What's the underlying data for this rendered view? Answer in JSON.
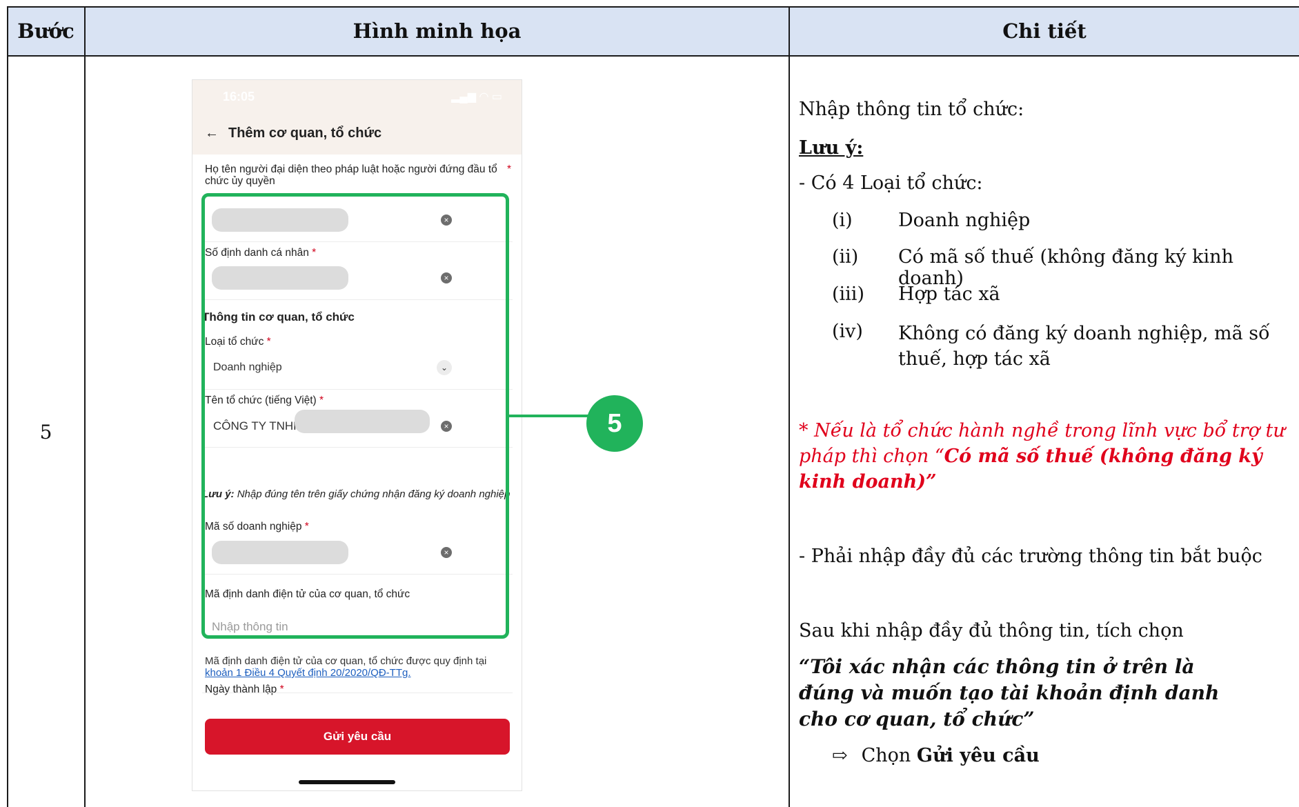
{
  "header": {
    "col_step": "Bước",
    "col_illustration": "Hình minh họa",
    "col_detail": "Chi tiết"
  },
  "step_number": "5",
  "phone": {
    "status_time": "16:05",
    "title": "Thêm cơ quan, tổ chức",
    "rep_label": "Họ tên người đại diện theo pháp luật hoặc người đứng đầu tổ chức ủy quyền",
    "id_label": "Số định danh cá nhân",
    "section_title": "Thông tin cơ quan, tổ chức",
    "org_type_label": "Loại tổ chức",
    "org_type_value": "Doanh nghiệp",
    "org_name_label": "Tên tổ chức (tiếng Việt)",
    "org_name_value": "CÔNG TY TNHH",
    "note_prefix": "Lưu ý:",
    "note_text": " Nhập đúng tên trên giấy chứng nhận đăng ký doanh nghiệp",
    "biz_code_label": "Mã số doanh nghiệp",
    "eid_label": "Mã định danh điện tử của cơ quan, tổ chức",
    "eid_placeholder": "Nhập thông tin",
    "footnote_text": "Mã định danh điện tử của cơ quan, tổ chức được quy định tại ",
    "footnote_link": "khoản 1 Điều 4 Quyết định 20/2020/QĐ-TTg.",
    "founding_label": "Ngày thành lập",
    "required_mark": "*",
    "submit_label": "Gửi yêu cầu",
    "callout_number": "5"
  },
  "detail": {
    "intro": "Nhập thông tin tổ chức:",
    "note_heading": "Lưu ý:",
    "types_intro": "- Có 4 Loại tổ chức:",
    "types": [
      {
        "num": "(i)",
        "text": "Doanh nghiệp"
      },
      {
        "num": "(ii)",
        "text": "Có mã số thuế (không đăng ký kinh doanh)"
      },
      {
        "num": "(iii)",
        "text": "Hợp tác xã"
      },
      {
        "num": "(iv)",
        "text": "Không có đăng ký doanh nghiệp, mã số thuế, hợp tác xã"
      }
    ],
    "red_note_prefix": "* Nếu là tổ chức hành nghề trong lĩnh vực bổ trợ tư pháp thì chọn “",
    "red_note_bold": "Có mã số thuế (không đăng ký kinh doanh)”",
    "required_note": "- Phải nhập đầy đủ các trường thông tin bắt buộc",
    "after_fill": "Sau khi nhập đầy đủ thông tin, tích chọn",
    "confirm_quote": "“Tôi xác nhận các thông tin ở trên là đúng và muốn tạo tài khoản định danh cho cơ quan, tổ chức”",
    "choose_arrow": "⇨",
    "choose_prefix": "Chọn ",
    "choose_bold": "Gửi yêu cầu"
  },
  "colors": {
    "header_bg": "#d9e3f3",
    "highlight_green": "#21b35b",
    "submit_red": "#d7152a",
    "note_red": "#e0001b"
  }
}
